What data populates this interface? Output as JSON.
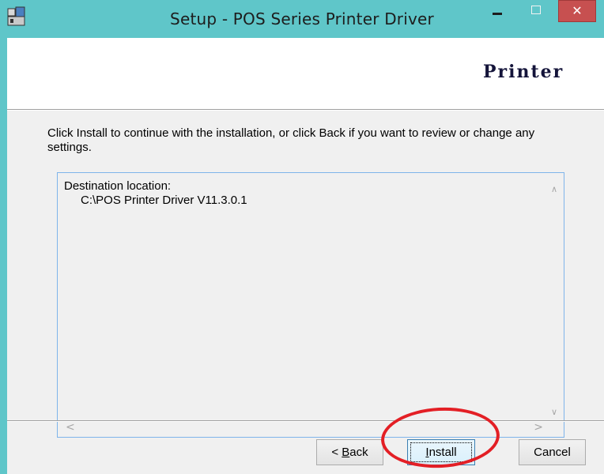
{
  "window": {
    "title": "Setup - POS Series Printer Driver",
    "close_symbol": "✕",
    "icons": [
      "setup-app-icon",
      "minimize-icon",
      "maximize-icon",
      "close-icon"
    ]
  },
  "header": {
    "brand": "Printer"
  },
  "content": {
    "instructions": "Click Install to continue with the installation, or click Back if you want to review or change any settings.",
    "memo": {
      "label": "Destination location:",
      "path": "C:\\POS Printer Driver V11.3.0.1"
    },
    "scroll_symbols": {
      "up": "∧",
      "down": "∨",
      "left": "<",
      "right": ">"
    }
  },
  "buttons": {
    "back_prefix": "< ",
    "back_hotkey": "B",
    "back_rest": "ack",
    "install_hotkey": "I",
    "install_rest": "nstall",
    "cancel": "Cancel"
  },
  "colors": {
    "frame": "#5fc6c9",
    "close_button": "#c75050",
    "highlight": "#e31f25",
    "memo_border": "#7eb4ea"
  }
}
